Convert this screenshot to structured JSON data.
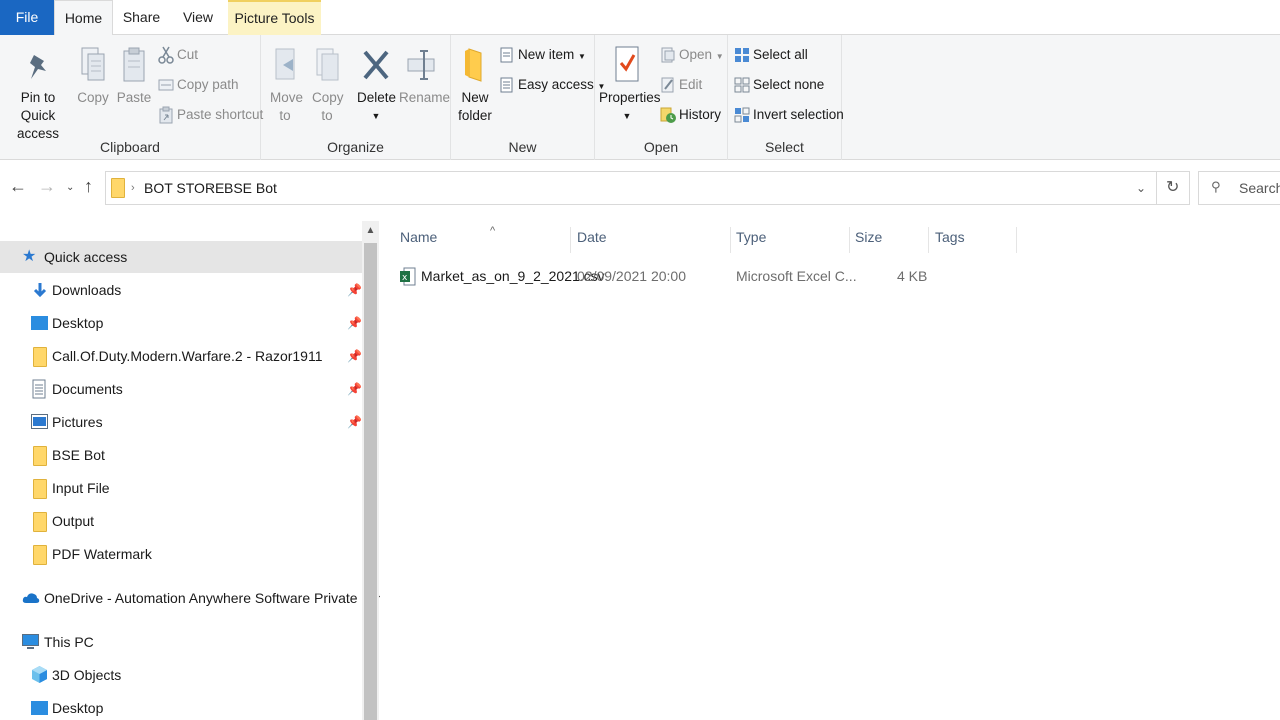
{
  "ribbon_tabs": {
    "file": "File",
    "home": "Home",
    "share": "Share",
    "view": "View",
    "picture_tools": "Picture Tools"
  },
  "clipboard": {
    "pin": "Pin to Quick access",
    "copy": "Copy",
    "paste": "Paste",
    "cut": "Cut",
    "copy_path": "Copy path",
    "paste_shortcut": "Paste shortcut",
    "label": "Clipboard"
  },
  "organize": {
    "move_to": "Move to",
    "copy_to": "Copy to",
    "delete": "Delete",
    "rename": "Rename",
    "label": "Organize"
  },
  "new_group": {
    "new_folder": "New folder",
    "new_item": "New item",
    "easy_access": "Easy access",
    "label": "New"
  },
  "open_group": {
    "properties": "Properties",
    "open": "Open",
    "edit": "Edit",
    "history": "History",
    "label": "Open"
  },
  "select_group": {
    "select_all": "Select all",
    "select_none": "Select none",
    "invert": "Invert selection",
    "label": "Select"
  },
  "breadcrumb": [
    "BOT STORE",
    "BSE Bot"
  ],
  "search": {
    "placeholder": "Search BSE Bot"
  },
  "nav": {
    "quick_access": "Quick access",
    "items": [
      {
        "label": "Downloads",
        "pinned": true,
        "icon": "download-icon"
      },
      {
        "label": "Desktop",
        "pinned": true,
        "icon": "desktop-icon"
      },
      {
        "label": "Call.Of.Duty.Modern.Warfare.2 - Razor1911",
        "pinned": true,
        "icon": "folder-icon"
      },
      {
        "label": "Documents",
        "pinned": true,
        "icon": "documents-icon"
      },
      {
        "label": "Pictures",
        "pinned": true,
        "icon": "pictures-icon"
      },
      {
        "label": "BSE Bot",
        "pinned": false,
        "icon": "folder-icon"
      },
      {
        "label": "Input File",
        "pinned": false,
        "icon": "folder-icon"
      },
      {
        "label": "Output",
        "pinned": false,
        "icon": "folder-icon"
      },
      {
        "label": "PDF Watermark",
        "pinned": false,
        "icon": "folder-icon"
      }
    ],
    "onedrive": "OneDrive - Automation Anywhere Software Private Limited",
    "this_pc": "This PC",
    "pc_items": [
      {
        "label": "3D Objects",
        "icon": "3d-objects-icon"
      },
      {
        "label": "Desktop",
        "icon": "desktop-icon"
      }
    ]
  },
  "columns": {
    "name": "Name",
    "date": "Date",
    "type": "Type",
    "size": "Size",
    "tags": "Tags"
  },
  "files": [
    {
      "name": "Market_as_on_9_2_2021.csv",
      "date": "02/09/2021 20:00",
      "type": "Microsoft Excel C...",
      "size": "4 KB",
      "tags": ""
    }
  ]
}
